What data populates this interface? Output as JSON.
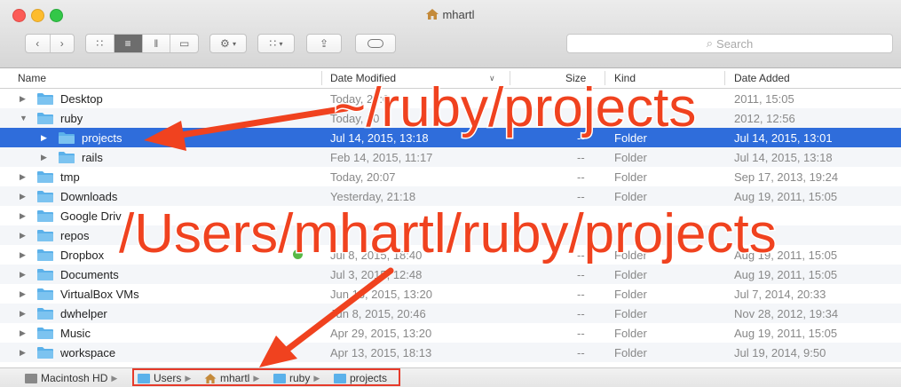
{
  "window": {
    "title": "mhartl",
    "search_placeholder": "Search"
  },
  "columns": {
    "name": "Name",
    "date_modified": "Date Modified",
    "size": "Size",
    "kind": "Kind",
    "date_added": "Date Added"
  },
  "rows": [
    {
      "name": "Desktop",
      "date": "Today, 20:0",
      "size": "",
      "kind": "",
      "added": "2011, 15:05",
      "indent": 0,
      "expanded": false
    },
    {
      "name": "ruby",
      "date": "Today, 20",
      "size": "",
      "kind": "",
      "added": "2012, 12:56",
      "indent": 0,
      "expanded": true
    },
    {
      "name": "projects",
      "date": "Jul 14, 2015, 13:18",
      "size": "--",
      "kind": "Folder",
      "added": "Jul 14, 2015, 13:01",
      "indent": 1,
      "expanded": false,
      "selected": true
    },
    {
      "name": "rails",
      "date": "Feb 14, 2015, 11:17",
      "size": "--",
      "kind": "Folder",
      "added": "Jul 14, 2015, 13:18",
      "indent": 1,
      "expanded": false
    },
    {
      "name": "tmp",
      "date": "Today, 20:07",
      "size": "--",
      "kind": "Folder",
      "added": "Sep 17, 2013, 19:24",
      "indent": 0,
      "expanded": false
    },
    {
      "name": "Downloads",
      "date": "Yesterday, 21:18",
      "size": "--",
      "kind": "Folder",
      "added": "Aug 19, 2011, 15:05",
      "indent": 0,
      "expanded": false
    },
    {
      "name": "Google Driv",
      "date": "",
      "size": "",
      "kind": "",
      "added": "",
      "indent": 0,
      "expanded": false
    },
    {
      "name": "repos",
      "date": "",
      "size": "",
      "kind": "",
      "added": "",
      "indent": 0,
      "expanded": false
    },
    {
      "name": "Dropbox",
      "date": "Jul 8, 2015, 18:40",
      "size": "--",
      "kind": "Folder",
      "added": "Aug 19, 2011, 15:05",
      "indent": 0,
      "expanded": false
    },
    {
      "name": "Documents",
      "date": "Jul 3, 2015, 12:48",
      "size": "--",
      "kind": "Folder",
      "added": "Aug 19, 2011, 15:05",
      "indent": 0,
      "expanded": false
    },
    {
      "name": "VirtualBox VMs",
      "date": "Jun 16, 2015, 13:20",
      "size": "--",
      "kind": "Folder",
      "added": "Jul 7, 2014, 20:33",
      "indent": 0,
      "expanded": false
    },
    {
      "name": "dwhelper",
      "date": "Jun 8, 2015, 20:46",
      "size": "--",
      "kind": "Folder",
      "added": "Nov 28, 2012, 19:34",
      "indent": 0,
      "expanded": false
    },
    {
      "name": "Music",
      "date": "Apr 29, 2015, 13:20",
      "size": "--",
      "kind": "Folder",
      "added": "Aug 19, 2011, 15:05",
      "indent": 0,
      "expanded": false
    },
    {
      "name": "workspace",
      "date": "Apr 13, 2015, 18:13",
      "size": "--",
      "kind": "Folder",
      "added": "Jul 19, 2014, 9:50",
      "indent": 0,
      "expanded": false
    }
  ],
  "pathbar": {
    "items": [
      "Macintosh HD",
      "Users",
      "mhartl",
      "ruby",
      "projects"
    ]
  },
  "annotations": {
    "relative_path": "~/ruby/projects",
    "absolute_path": "/Users/mhartl/ruby/projects"
  },
  "colors": {
    "selection": "#2f6ddb",
    "annotation": "#f0421f",
    "folder": "#5bb1ea"
  }
}
